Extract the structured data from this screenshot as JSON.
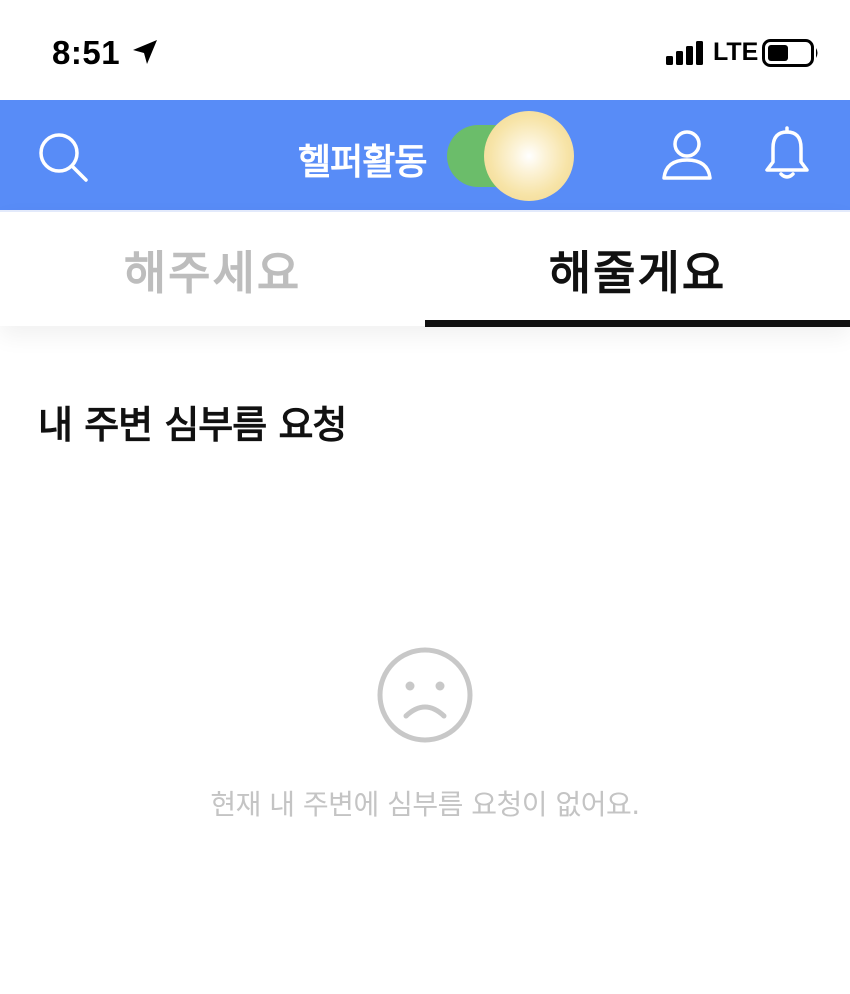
{
  "status_bar": {
    "time": "8:51",
    "network": "LTE",
    "icons": [
      "location-arrow-icon",
      "signal-bars-icon",
      "battery-icon"
    ]
  },
  "header": {
    "title": "헬퍼활동",
    "helper_toggle_on": true,
    "icons": [
      "search-icon",
      "profile-icon",
      "bell-icon"
    ],
    "colors": {
      "background": "#588cf7",
      "toggle_track": "#6bbd6a"
    }
  },
  "tabs": [
    {
      "label": "해주세요",
      "active": false
    },
    {
      "label": "해줄게요",
      "active": true
    }
  ],
  "main": {
    "section_title": "내 주변 심부름 요청",
    "empty_icon": "sad-face-icon",
    "empty_message": "현재 내 주변에 심부름 요청이 없어요."
  }
}
